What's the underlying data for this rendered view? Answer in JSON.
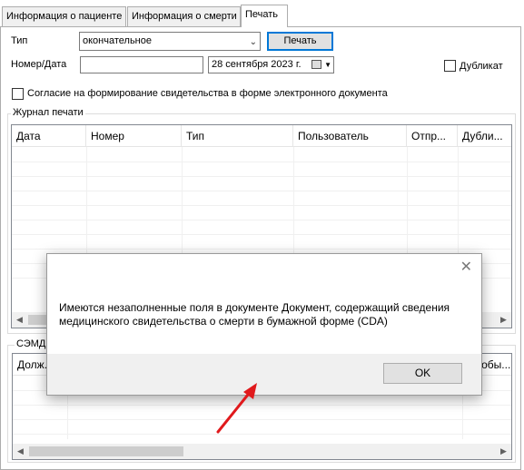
{
  "tabs": [
    {
      "label": "Информация о пациенте",
      "active": false
    },
    {
      "label": "Информация о смерти",
      "active": false
    },
    {
      "label": "Печать",
      "active": true
    }
  ],
  "form": {
    "type_label": "Тип",
    "type_value": "окончательное",
    "print_button": "Печать",
    "number_date_label": "Номер/Дата",
    "number_value": "",
    "date_value": "28 сентября 2023 г.",
    "duplicate_label": "Дубликат",
    "consent_label": "Согласие на формирование свидетельства в форме электронного документа"
  },
  "print_journal": {
    "title": "Журнал печати",
    "columns": [
      "Дата",
      "Номер",
      "Тип",
      "Пользователь",
      "Отпр...",
      "Дубли..."
    ]
  },
  "semd": {
    "title": "СЭМД",
    "first_column": "Долж...",
    "last_column": "...собы..."
  },
  "dialog": {
    "close_glyph": "✕",
    "message": "Имеются незаполненные поля в документе Документ, содержащий сведения медицинского свидетельства о смерти в бумажной форме (CDA)",
    "ok_label": "OK"
  },
  "colors": {
    "accent": "#0078d7",
    "annotation_arrow": "#e0191c"
  }
}
